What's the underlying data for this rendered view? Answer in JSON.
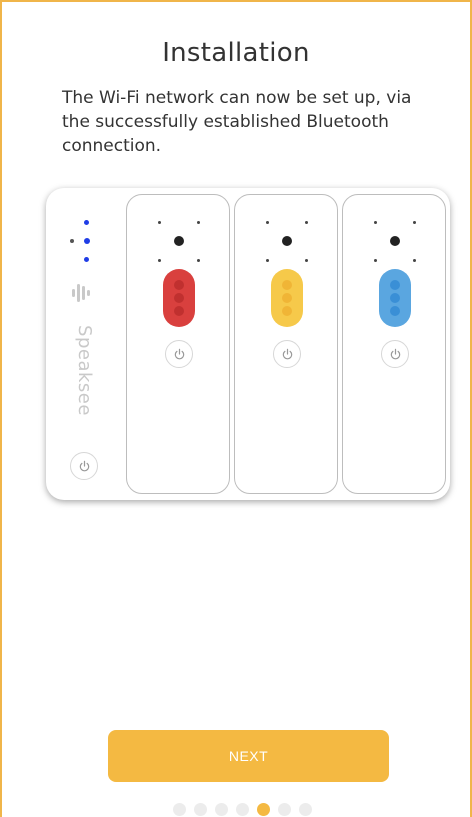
{
  "screen": {
    "title": "Installation",
    "subtitle": "The Wi-Fi network can now be set up, via the successfully established Bluetooth connection."
  },
  "device": {
    "brand_label": "Speaksee",
    "modules": [
      {
        "color": "#d9403e",
        "led_color": "#c0302f"
      },
      {
        "color": "#f6c94a",
        "led_color": "#f0b536"
      },
      {
        "color": "#5aa6e0",
        "led_color": "#3a8fd6"
      }
    ],
    "status_dot_color": "#1f3de6"
  },
  "actions": {
    "next_label": "NEXT"
  },
  "pager": {
    "total": 7,
    "active_index": 4
  },
  "colors": {
    "accent": "#f4b942",
    "border": "#f0b54a"
  }
}
